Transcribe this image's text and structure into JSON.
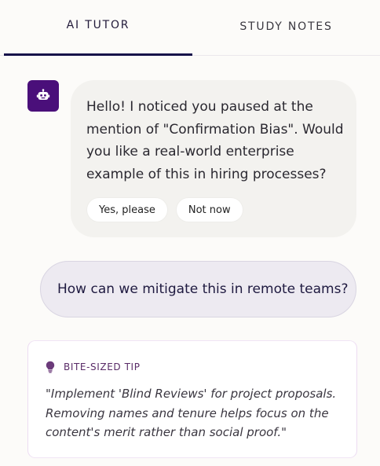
{
  "tabs": [
    {
      "label": "AI TUTOR",
      "active": true
    },
    {
      "label": "STUDY NOTES",
      "active": false
    }
  ],
  "colors": {
    "accent": "#16124a",
    "avatar_bg": "#4a0f7a",
    "bot_bubble": "#f3f2ef",
    "user_bubble": "#edeaf1",
    "tip_label": "#5a2c68"
  },
  "chat": {
    "bot_avatar_icon": "robot-icon",
    "bot_message": "Hello! I noticed you paused at the mention of \"Confirmation Bias\". Would you like a real-world enterprise example of this in hiring processes?",
    "quick_replies": [
      "Yes, please",
      "Not now"
    ],
    "user_message": "How can we mitigate this in remote teams?"
  },
  "tip": {
    "icon": "lightbulb-icon",
    "label": "BITE-SIZED TIP",
    "text": "\"Implement 'Blind Reviews' for project proposals. Removing names and tenure helps focus on the content's merit rather than social proof.\""
  }
}
